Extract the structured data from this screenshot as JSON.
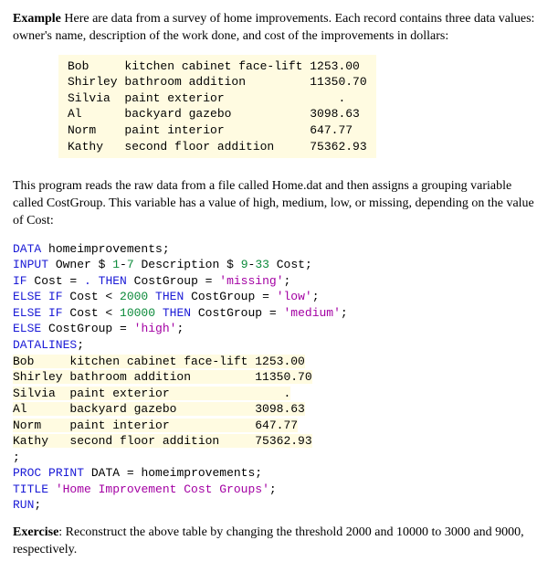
{
  "example": {
    "label": "Example",
    "intro_rest": " Here are data from a survey of home improvements. Each record contains three data values: owner's name, description of the work done, and cost of the improvements in dollars:"
  },
  "data_rows": [
    {
      "owner": "Bob",
      "desc": "kitchen cabinet face-lift",
      "cost": "1253.00"
    },
    {
      "owner": "Shirley",
      "desc": "bathroom addition",
      "cost": "11350.70"
    },
    {
      "owner": "Silvia",
      "desc": "paint exterior",
      "cost": "."
    },
    {
      "owner": "Al",
      "desc": "backyard gazebo",
      "cost": "3098.63"
    },
    {
      "owner": "Norm",
      "desc": "paint interior",
      "cost": "647.77"
    },
    {
      "owner": "Kathy",
      "desc": "second floor addition",
      "cost": "75362.93"
    }
  ],
  "para2": "This program reads the raw data from a file called Home.dat and then assigns a grouping variable called CostGroup. This variable has a value of high, medium, low, or missing, depending on the value of Cost:",
  "code": {
    "l1": {
      "kw": "DATA",
      "rest": " homeimprovements;"
    },
    "l2": {
      "kw": "INPUT",
      "mid1": " Owner $ ",
      "n1": "1",
      "dash": "-",
      "n2": "7",
      "mid2": " Description $ ",
      "n3": "9",
      "dash2": "-",
      "n4": "33",
      "mid3": " Cost;"
    },
    "l3": {
      "kw": "IF",
      "mid": " Cost = ",
      "dot": ".",
      "then": " THEN",
      "mid2": " CostGroup = ",
      "str": "'missing'",
      "end": ";"
    },
    "l4": {
      "kw": "ELSE IF",
      "mid": " Cost < ",
      "num": "2000",
      "then": " THEN",
      "mid2": " CostGroup = ",
      "str": "'low'",
      "end": ";"
    },
    "l5": {
      "kw": "ELSE IF",
      "mid": " Cost < ",
      "num": "10000",
      "then": " THEN",
      "mid2": " CostGroup = ",
      "str": "'medium'",
      "end": ";"
    },
    "l6": {
      "kw": "ELSE",
      "mid": " CostGroup = ",
      "str": "'high'",
      "end": ";"
    },
    "l7": {
      "kw": "DATALINES",
      "end": ";"
    },
    "semicolon": ";",
    "l8": {
      "kw": "PROC",
      "kw2": "PRINT",
      "mid": " DATA = homeimprovements;"
    },
    "l9": {
      "kw": "TITLE",
      "sp": " ",
      "str": "'Home Improvement Cost Groups'",
      "end": ";"
    },
    "l10": {
      "kw": "RUN",
      "end": ";"
    }
  },
  "exercise": {
    "label": "Exercise",
    "rest": ": Reconstruct the above table by changing the threshold 2000 and 10000 to 3000 and 9000, respectively."
  }
}
